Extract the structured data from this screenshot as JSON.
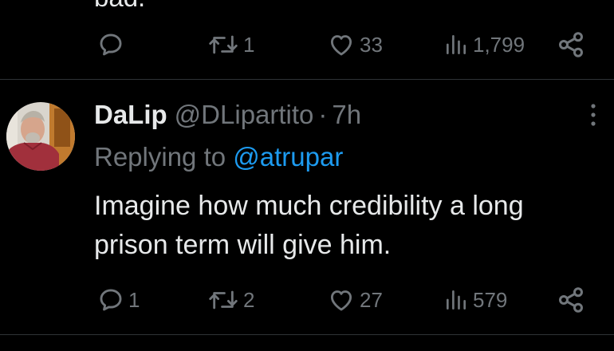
{
  "colors": {
    "background": "#000000",
    "text_primary": "#e7e9ea",
    "text_secondary": "#71767b",
    "link": "#1d9bf0",
    "divider": "#2f3336"
  },
  "previous_tweet": {
    "cut_text": "bad.",
    "actions": {
      "reply": {
        "icon": "reply-icon",
        "count": ""
      },
      "repost": {
        "icon": "repost-icon",
        "count": "1"
      },
      "like": {
        "icon": "heart-icon",
        "count": "33"
      },
      "views": {
        "icon": "views-icon",
        "count": "1,799"
      },
      "share": {
        "icon": "share-icon"
      }
    }
  },
  "reply_tweet": {
    "display_name": "DaLip",
    "handle": "@DLipartito",
    "separator": "·",
    "time": "7h",
    "replying_to_label": "Replying to",
    "replying_to_handle": "@atrupar",
    "body_lines": [
      "Imagine how much credibility a long",
      "prison term will give him."
    ],
    "actions": {
      "reply": {
        "icon": "reply-icon",
        "count": "1"
      },
      "repost": {
        "icon": "repost-icon",
        "count": "2"
      },
      "like": {
        "icon": "heart-icon",
        "count": "27"
      },
      "views": {
        "icon": "views-icon",
        "count": "579"
      },
      "share": {
        "icon": "share-icon"
      }
    },
    "more_icon": "more-vertical-icon",
    "avatar_icon": "avatar"
  }
}
